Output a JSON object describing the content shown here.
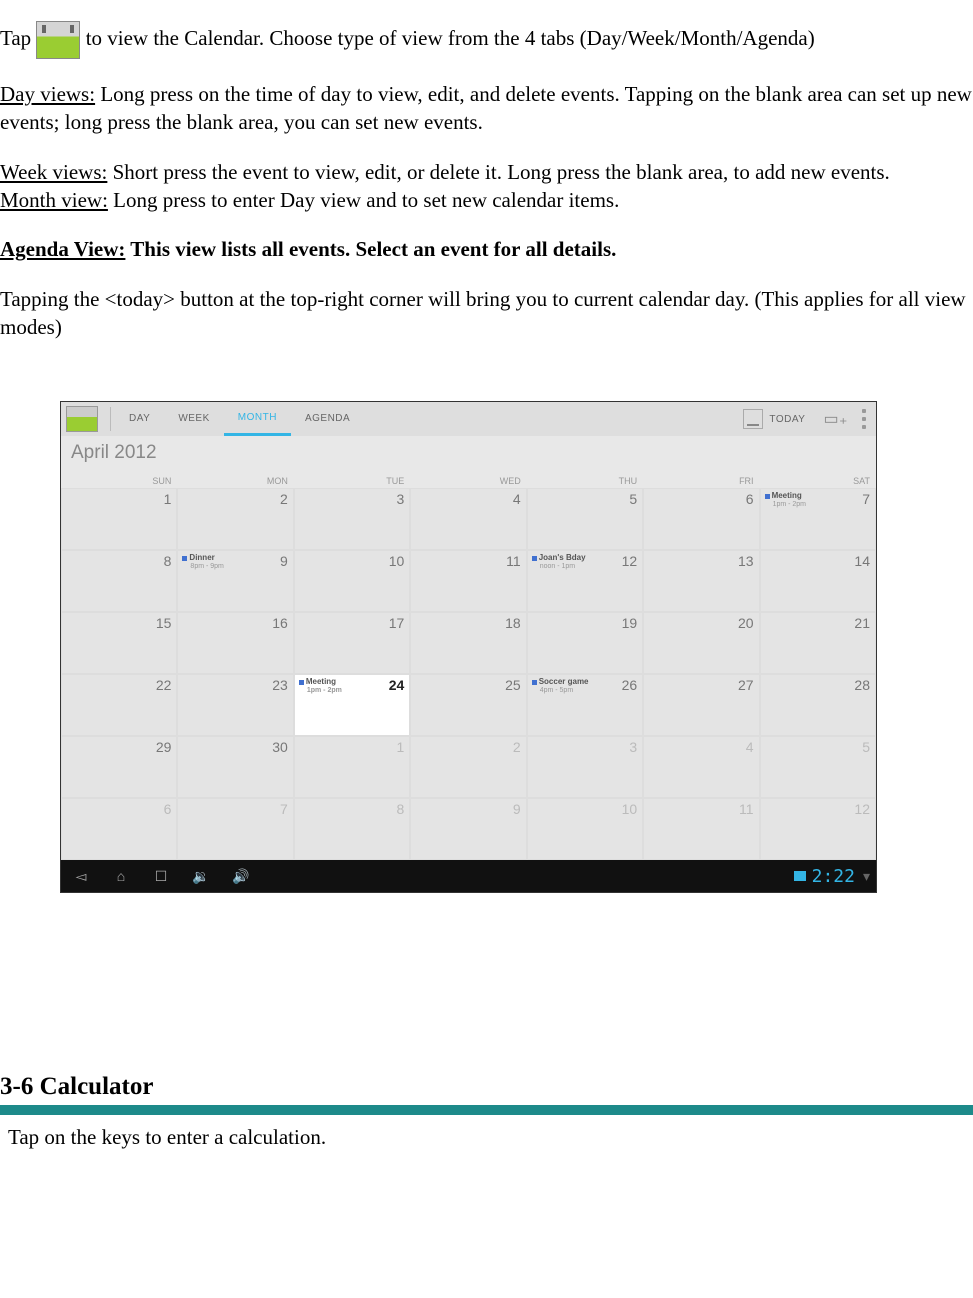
{
  "doc": {
    "line1a": "Tap ",
    "line1b": " to view the Calendar.    Choose type of view from the 4 tabs (Day/Week/Month/Agenda)",
    "dayviews_label": "Day views:",
    "dayviews_text": " Long press on the time of day to view, edit, and delete events.    Tapping on the blank area can set up new events; long press the blank area, you can set new events.",
    "weekviews_label": "Week views:",
    "weekviews_text": " Short press the event to view, edit, or delete it.    Long press the blank area, to add new events.",
    "monthview_label": "Month view:",
    "monthview_text": " Long press to enter Day view and to set new calendar items.",
    "agenda_label": "Agenda View:",
    "agenda_text": " This view lists all events. Select an event for all details.",
    "today_note": "Tapping the <today> button at the top-right corner will bring you to current calendar day.    (This applies for all view modes)",
    "section_heading": "3-6 Calculator",
    "calc_text": "Tap on the keys to enter a calculation."
  },
  "screenshot": {
    "tabs": [
      "DAY",
      "WEEK",
      "MONTH",
      "AGENDA"
    ],
    "active_tab": "MONTH",
    "today_button": "TODAY",
    "month_label": "April 2012",
    "day_headers": [
      "SUN",
      "MON",
      "TUE",
      "WED",
      "THU",
      "FRI",
      "SAT"
    ],
    "weeks": [
      [
        {
          "n": "1"
        },
        {
          "n": "2"
        },
        {
          "n": "3"
        },
        {
          "n": "4"
        },
        {
          "n": "5"
        },
        {
          "n": "6"
        },
        {
          "n": "7",
          "event": {
            "title": "Meeting",
            "time": "1pm - 2pm"
          }
        }
      ],
      [
        {
          "n": "8"
        },
        {
          "n": "9",
          "event": {
            "title": "Dinner",
            "time": "8pm - 9pm"
          }
        },
        {
          "n": "10"
        },
        {
          "n": "11"
        },
        {
          "n": "12",
          "event": {
            "title": "Joan's Bday",
            "time": "noon - 1pm"
          }
        },
        {
          "n": "13"
        },
        {
          "n": "14"
        }
      ],
      [
        {
          "n": "15"
        },
        {
          "n": "16"
        },
        {
          "n": "17"
        },
        {
          "n": "18"
        },
        {
          "n": "19"
        },
        {
          "n": "20"
        },
        {
          "n": "21"
        }
      ],
      [
        {
          "n": "22"
        },
        {
          "n": "23"
        },
        {
          "n": "24",
          "today": true,
          "event": {
            "title": "Meeting",
            "time": "1pm - 2pm"
          }
        },
        {
          "n": "25"
        },
        {
          "n": "26",
          "event": {
            "title": "Soccer game",
            "time": "4pm - 5pm"
          }
        },
        {
          "n": "27"
        },
        {
          "n": "28"
        }
      ],
      [
        {
          "n": "29"
        },
        {
          "n": "30"
        },
        {
          "n": "1",
          "other": true
        },
        {
          "n": "2",
          "other": true
        },
        {
          "n": "3",
          "other": true
        },
        {
          "n": "4",
          "other": true
        },
        {
          "n": "5",
          "other": true
        }
      ],
      [
        {
          "n": "6",
          "other": true
        },
        {
          "n": "7",
          "other": true
        },
        {
          "n": "8",
          "other": true
        },
        {
          "n": "9",
          "other": true
        },
        {
          "n": "10",
          "other": true
        },
        {
          "n": "11",
          "other": true
        },
        {
          "n": "12",
          "other": true
        }
      ]
    ],
    "clock": "2:22"
  }
}
